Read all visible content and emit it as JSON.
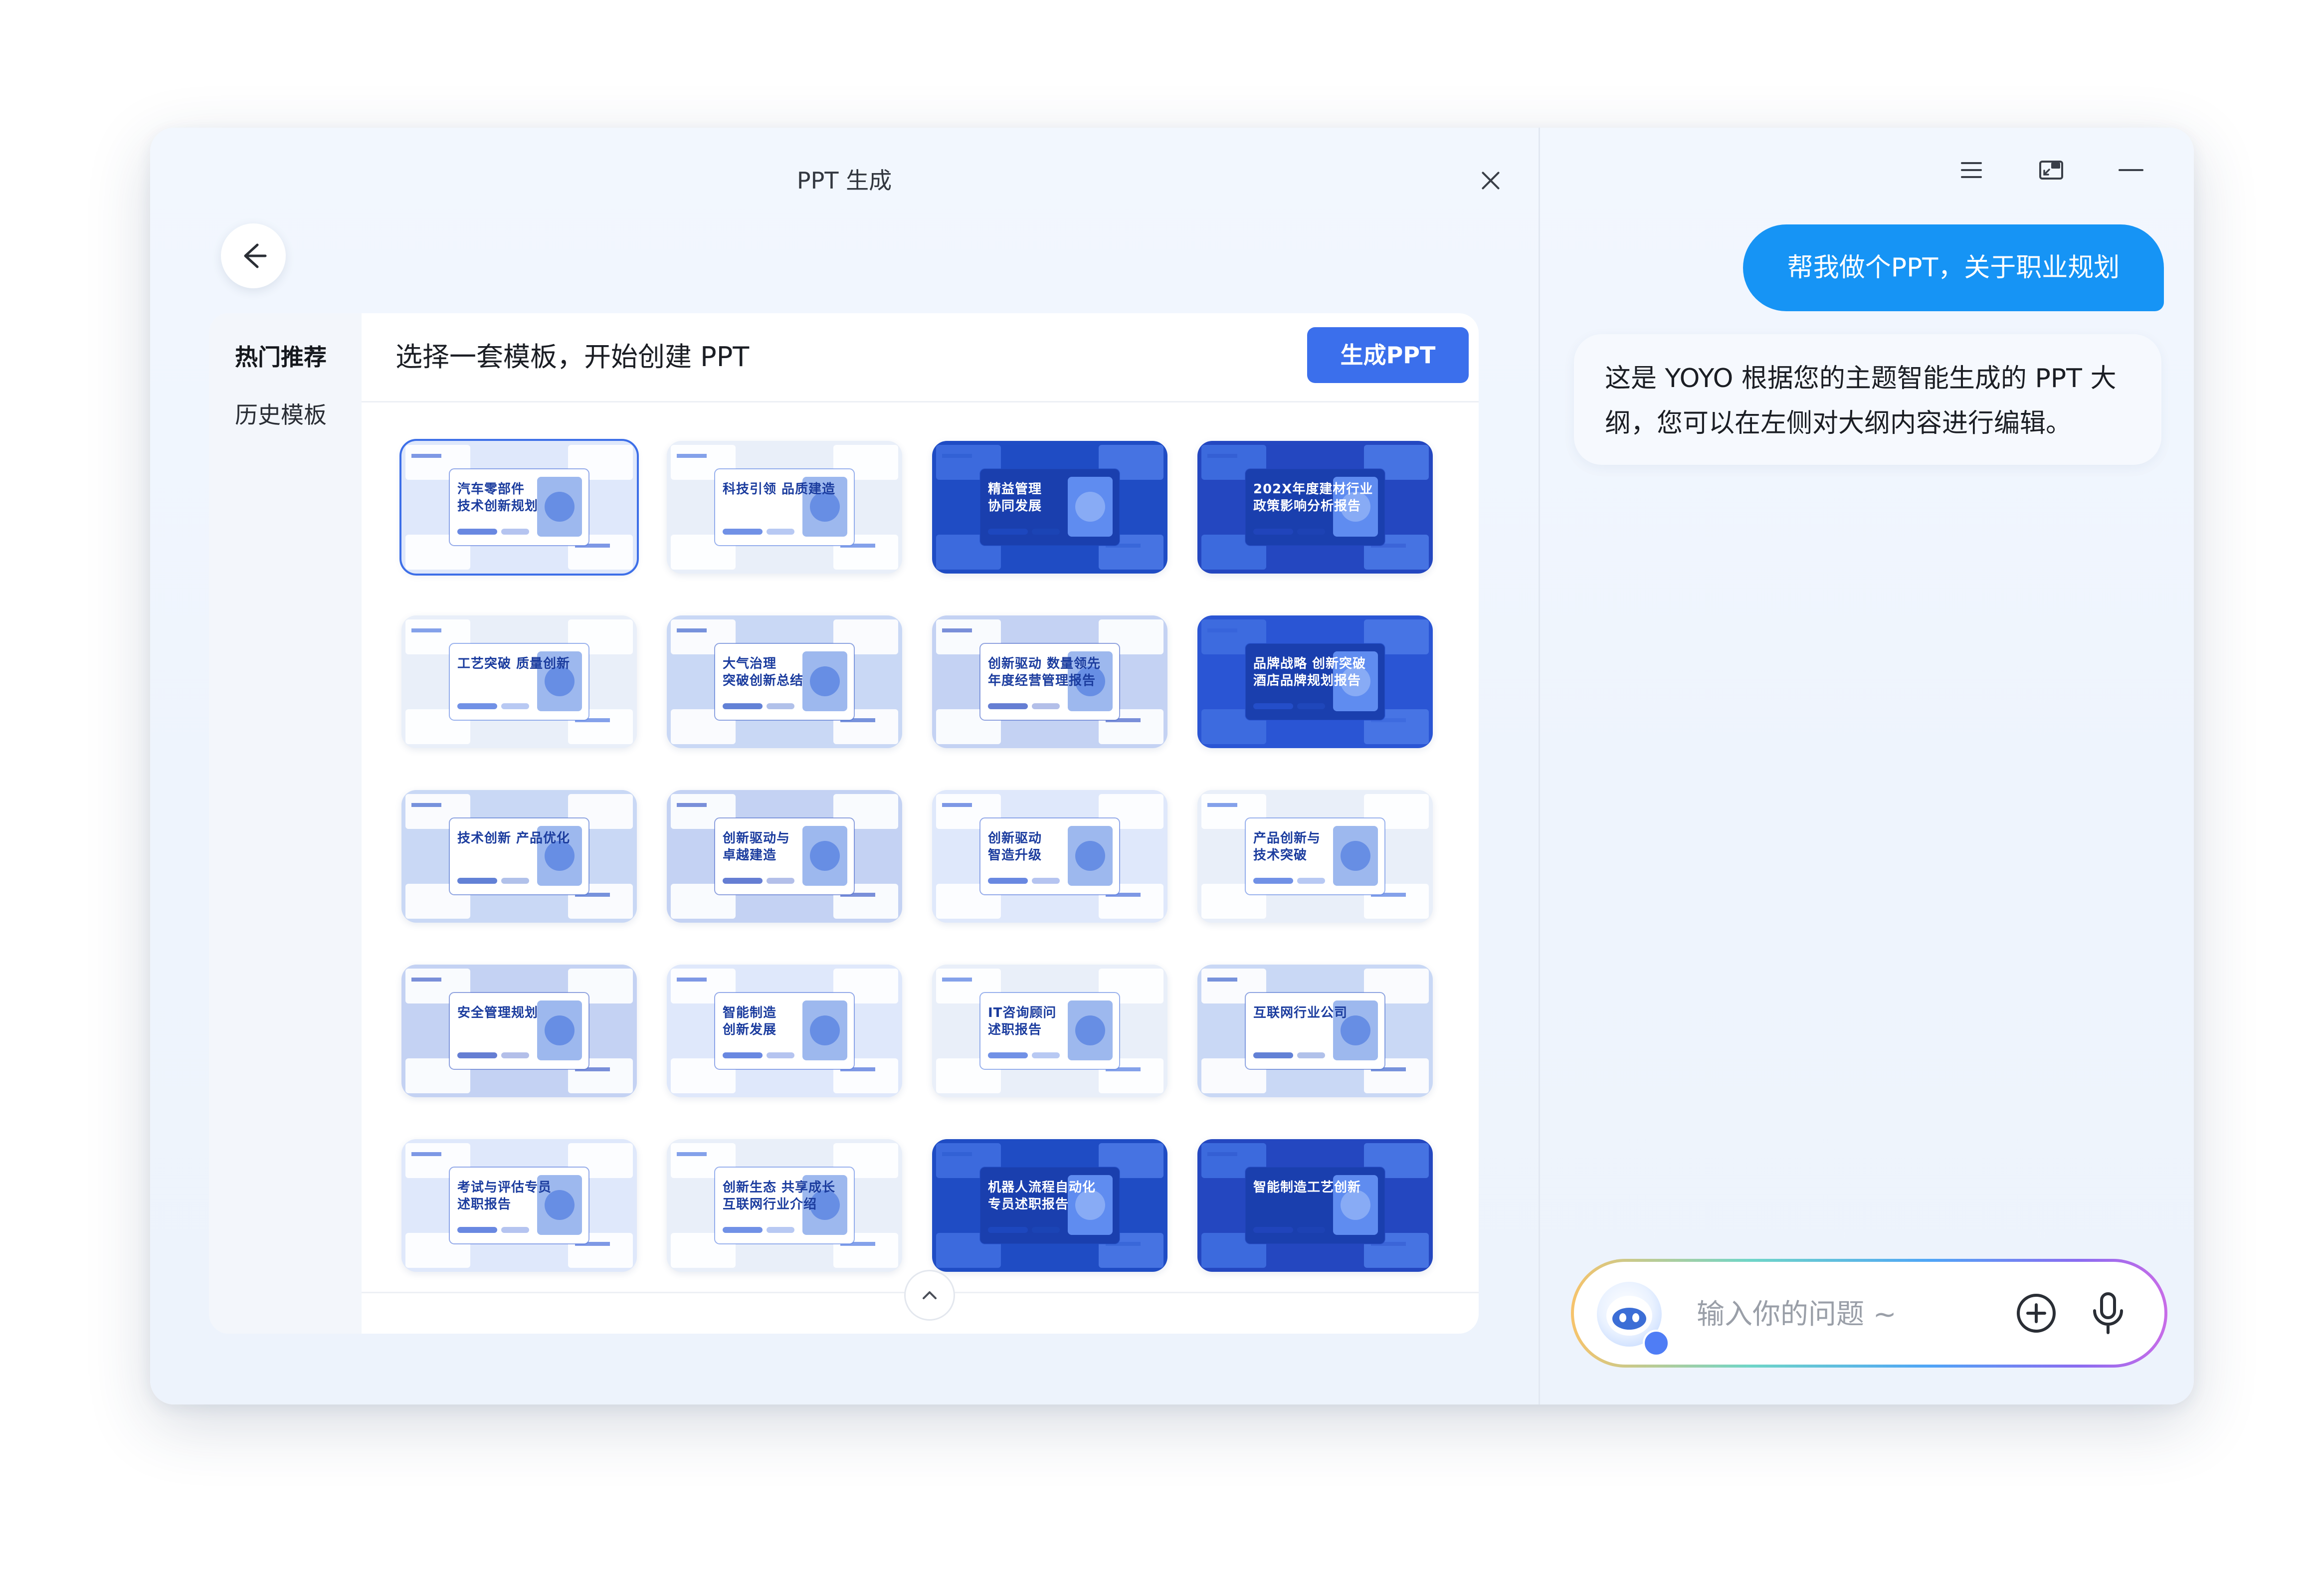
{
  "left": {
    "title": "PPT 生成",
    "tabs": [
      {
        "label": "热门推荐",
        "active": true
      },
      {
        "label": "历史模板",
        "active": false
      }
    ],
    "heading": "选择一套模板，开始创建 PPT",
    "generate_label": "生成PPT",
    "templates": [
      {
        "title": "汽车零部件\n技术创新规划",
        "selected": true
      },
      {
        "title": "科技引领 品质建造",
        "selected": false
      },
      {
        "title": "精益管理\n协同发展",
        "selected": false
      },
      {
        "title": "202X年度建材行业\n政策影响分析报告",
        "selected": false
      },
      {
        "title": "工艺突破 质量创新",
        "selected": false
      },
      {
        "title": "大气治理\n突破创新总结",
        "selected": false
      },
      {
        "title": "创新驱动 数量领先\n年度经营管理报告",
        "selected": false
      },
      {
        "title": "品牌战略 创新突破\n酒店品牌规划报告",
        "selected": false
      },
      {
        "title": "技术创新 产品优化",
        "selected": false
      },
      {
        "title": "创新驱动与\n卓越建造",
        "selected": false
      },
      {
        "title": "创新驱动\n智造升级",
        "selected": false
      },
      {
        "title": "产品创新与\n技术突破",
        "selected": false
      },
      {
        "title": "安全管理规划",
        "selected": false
      },
      {
        "title": "智能制造\n创新发展",
        "selected": false
      },
      {
        "title": "IT咨询顾问\n述职报告",
        "selected": false
      },
      {
        "title": "互联网行业公司",
        "selected": false
      },
      {
        "title": "考试与评估专员\n述职报告",
        "selected": false
      },
      {
        "title": "创新生态 共享成长\n互联网行业介绍",
        "selected": false
      },
      {
        "title": "机器人流程自动化\n专员述职报告",
        "selected": false
      },
      {
        "title": "智能制造工艺创新",
        "selected": false
      }
    ]
  },
  "right": {
    "user_message": "帮我做个PPT，关于职业规划",
    "ai_message": "这是 YOYO 根据您的主题智能生成的 PPT 大纲，您可以在左侧对大纲内容进行编辑。",
    "input_placeholder": "输入你的问题 ~",
    "accent": "#1694f5"
  },
  "colors": {
    "primary": "#3b6fec",
    "template_blue": "#2f5fd8"
  }
}
